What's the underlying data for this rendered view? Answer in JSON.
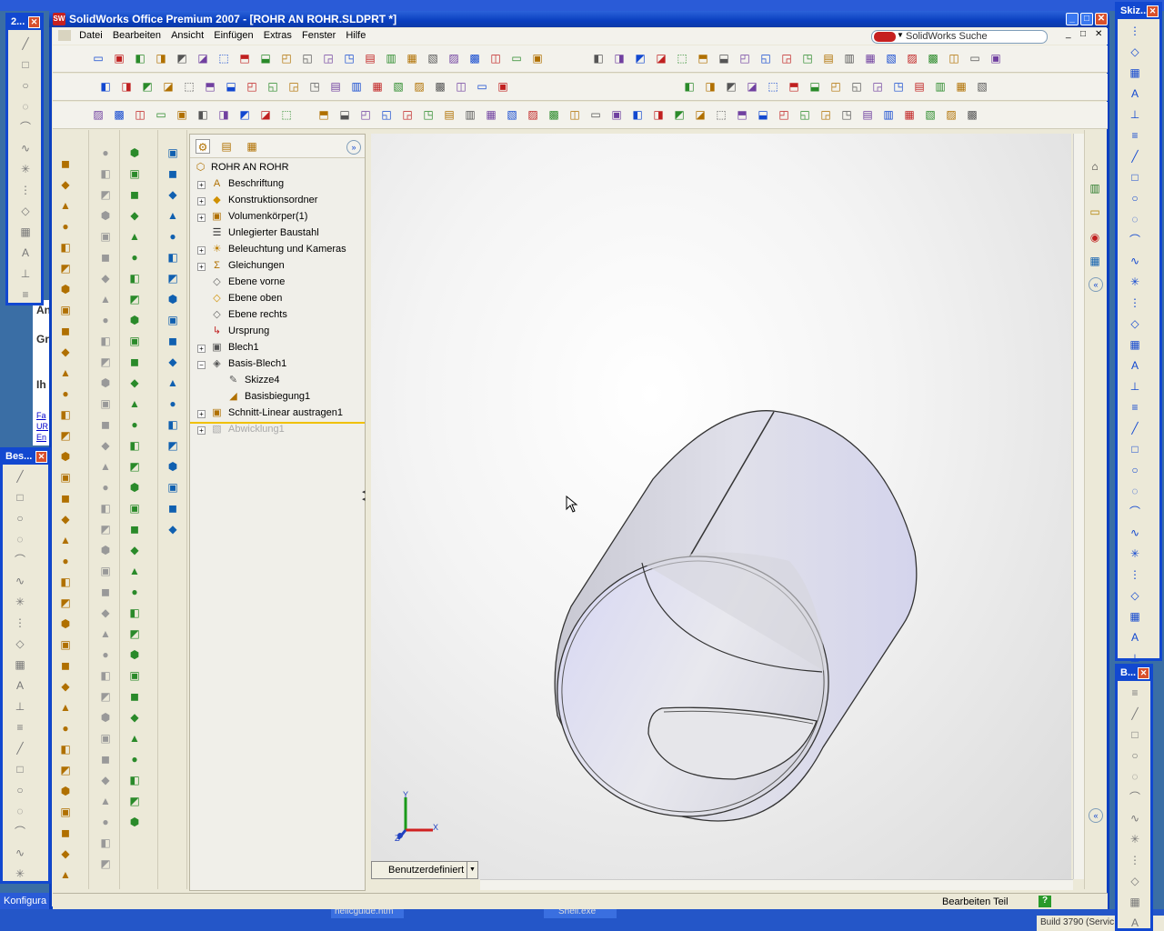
{
  "main_window": {
    "title": "SolidWorks Office Premium 2007 - [ROHR AN ROHR.SLDPRT *]"
  },
  "menu": [
    {
      "label": "Datei"
    },
    {
      "label": "Bearbeiten"
    },
    {
      "label": "Ansicht"
    },
    {
      "label": "Einfügen"
    },
    {
      "label": "Extras"
    },
    {
      "label": "Fenster"
    },
    {
      "label": "Hilfe"
    }
  ],
  "search": {
    "label": "SolidWorks Suche"
  },
  "feature_tree": {
    "root": "ROHR AN ROHR",
    "items": [
      {
        "label": "Beschriftung"
      },
      {
        "label": "Konstruktionsordner"
      },
      {
        "label": "Volumenkörper(1)"
      },
      {
        "label": "Unlegierter Baustahl"
      },
      {
        "label": "Beleuchtung und Kameras"
      },
      {
        "label": "Gleichungen"
      },
      {
        "label": "Ebene vorne"
      },
      {
        "label": "Ebene oben"
      },
      {
        "label": "Ebene rechts"
      },
      {
        "label": "Ursprung"
      },
      {
        "label": "Blech1"
      },
      {
        "label": "Basis-Blech1"
      },
      {
        "label": "Skizze4"
      },
      {
        "label": "Basisbiegung1"
      },
      {
        "label": "Schnitt-Linear austragen1"
      },
      {
        "label": "Abwicklung1"
      }
    ]
  },
  "view": {
    "config_label": "Benutzerdefiniert",
    "axis_x": "X",
    "axis_y": "Y",
    "axis_z": "Z"
  },
  "status": {
    "mode": "Bearbeiten Teil",
    "help": "?"
  },
  "floating": {
    "left_top_title": "2...",
    "left_bottom_title": "Bes...",
    "right_top_title": "Skiz...",
    "right_bottom_title": "B..."
  },
  "background": {
    "config_text": "Konfigura",
    "task_item1": "hellcguide.htm",
    "task_item2": "Shell.exe",
    "build": "Build 3790 (Servic",
    "text_an": "An",
    "text_gr": "Gr",
    "text_ih": "Ih",
    "text_fa": "Fa",
    "text_ur": "UR",
    "text_en": "En"
  }
}
